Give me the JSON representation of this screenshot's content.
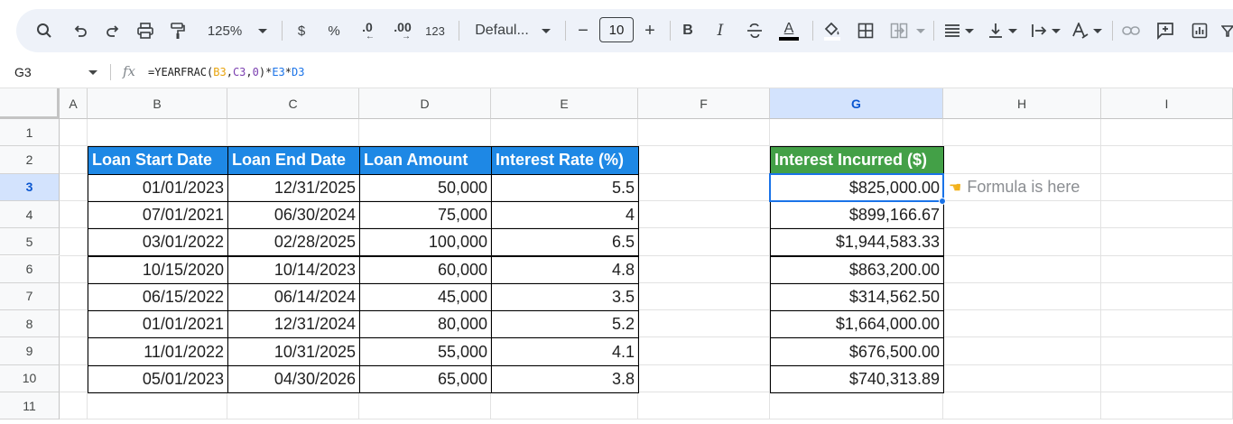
{
  "toolbar": {
    "zoom": "125%",
    "currency": "$",
    "percent": "%",
    "decrease_decimal": ".0",
    "increase_decimal": ".00",
    "number_format": "123",
    "font_name": "Defaul...",
    "font_size": "10",
    "bold": "B",
    "italic": "I",
    "text_color": "A",
    "minus": "−",
    "plus": "+"
  },
  "formula_bar": {
    "cell_ref": "G3",
    "fx": "fx",
    "formula_parts": [
      "=YEARFRAC(",
      "B3",
      ",",
      "C3",
      ",",
      "0",
      ")*",
      "E3",
      "*",
      "D3"
    ]
  },
  "columns": [
    "A",
    "B",
    "C",
    "D",
    "E",
    "F",
    "G",
    "H",
    "I"
  ],
  "rows": [
    "1",
    "2",
    "3",
    "4",
    "5",
    "6",
    "7",
    "8",
    "9",
    "10",
    "11"
  ],
  "selected_cell": {
    "column": "G",
    "row": "3"
  },
  "table": {
    "headers": [
      "Loan Start Date",
      "Loan End Date",
      "Loan Amount",
      "Interest Rate (%)"
    ],
    "rows": [
      [
        "01/01/2023",
        "12/31/2025",
        "50,000",
        "5.5"
      ],
      [
        "07/01/2021",
        "06/30/2024",
        "75,000",
        "4"
      ],
      [
        "03/01/2022",
        "02/28/2025",
        "100,000",
        "6.5"
      ],
      [
        "10/15/2020",
        "10/14/2023",
        "60,000",
        "4.8"
      ],
      [
        "06/15/2022",
        "06/14/2024",
        "45,000",
        "3.5"
      ],
      [
        "01/01/2021",
        "12/31/2024",
        "80,000",
        "5.2"
      ],
      [
        "11/01/2022",
        "10/31/2025",
        "55,000",
        "4.1"
      ],
      [
        "05/01/2023",
        "04/30/2026",
        "65,000",
        "3.8"
      ]
    ]
  },
  "result": {
    "header": "Interest Incurred ($)",
    "values": [
      "$825,000.00",
      "$899,166.67",
      "$1,944,583.33",
      "$863,200.00",
      "$314,562.50",
      "$1,664,000.00",
      "$676,500.00",
      "$740,313.89"
    ]
  },
  "annotation": {
    "text": "Formula is here",
    "icon": "pointing-hand-icon"
  },
  "colors": {
    "header_blue": "#1e88e5",
    "header_green": "#43a047",
    "selection": "#1a73e8"
  }
}
